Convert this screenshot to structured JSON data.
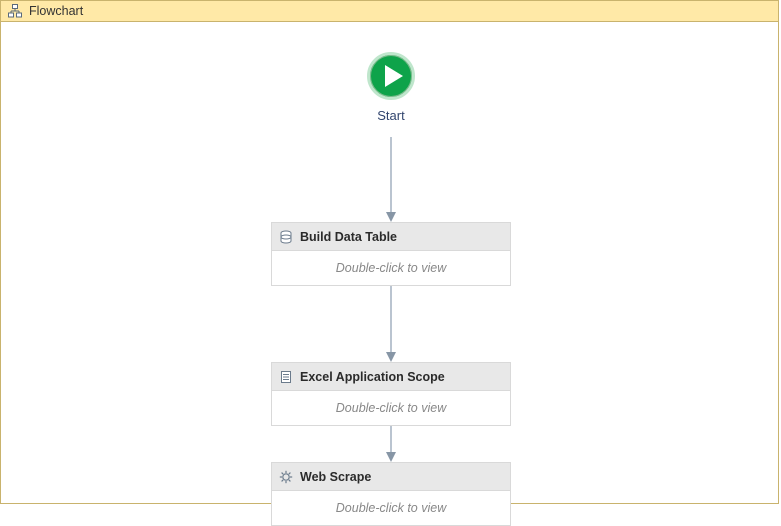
{
  "header": {
    "title": "Flowchart"
  },
  "start": {
    "label": "Start"
  },
  "activities": [
    {
      "title": "Build Data Table",
      "hint": "Double-click to view",
      "icon": "datatable-icon"
    },
    {
      "title": "Excel Application Scope",
      "hint": "Double-click to view",
      "icon": "document-icon"
    },
    {
      "title": "Web Scrape",
      "hint": "Double-click to view",
      "icon": "gear-icon"
    }
  ]
}
